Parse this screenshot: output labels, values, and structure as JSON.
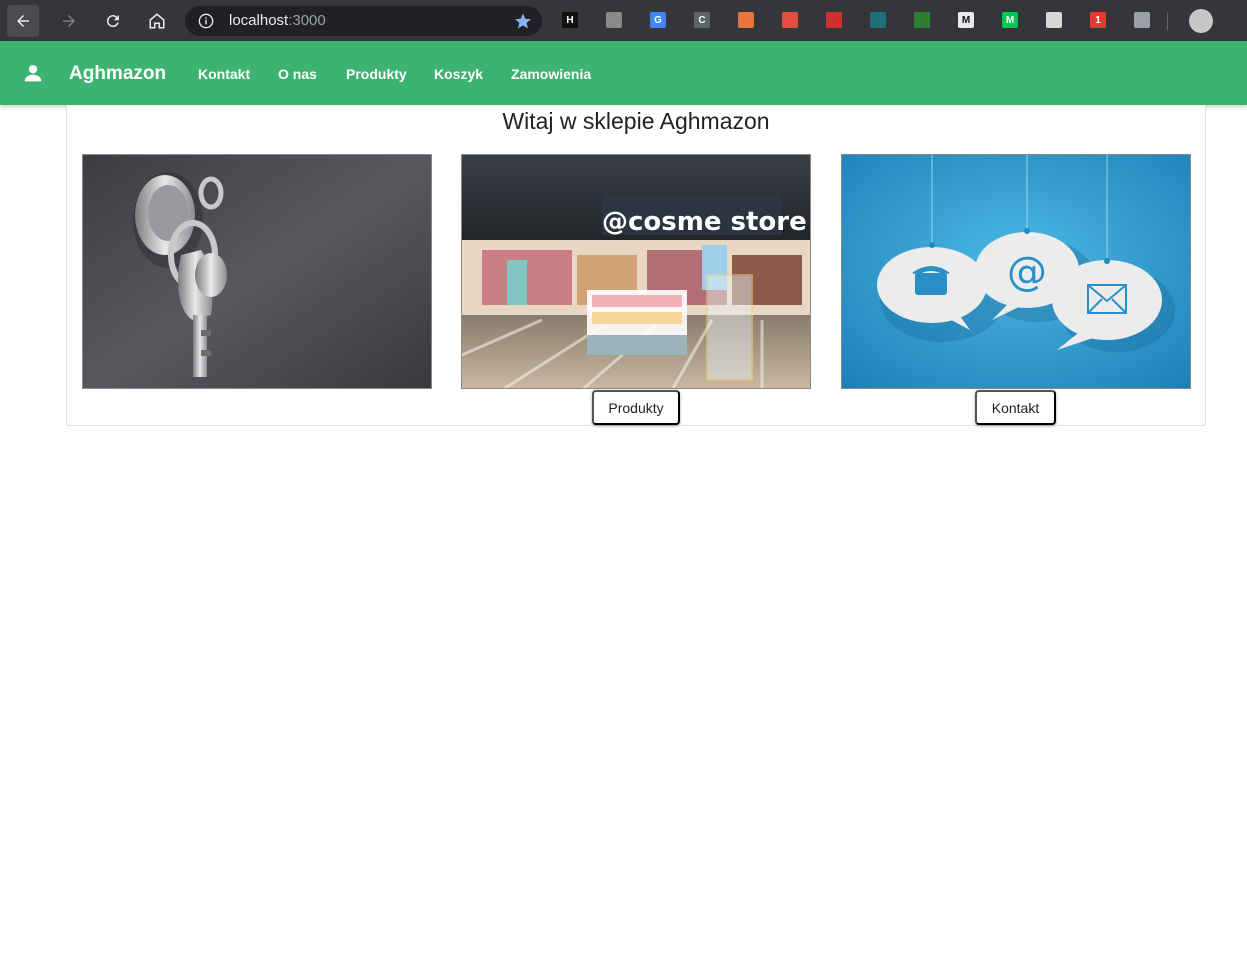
{
  "browser": {
    "url_host": "localhost",
    "url_port": ":3000",
    "extensions": [
      {
        "icon": "h-icon",
        "label": "H",
        "color": "#111111"
      },
      {
        "icon": "link-icon",
        "label": "",
        "color": "#8a8a8a"
      },
      {
        "icon": "translate-icon",
        "label": "G",
        "color": "#4285f4"
      },
      {
        "icon": "c-icon",
        "label": "C",
        "color": "#5f6368"
      },
      {
        "icon": "drop-icon",
        "label": "",
        "color": "#e8743b"
      },
      {
        "icon": "grid-icon",
        "label": "",
        "color": "#e44d3a"
      },
      {
        "icon": "pocket-icon",
        "label": "",
        "color": "#d32f2f"
      },
      {
        "icon": "globe-icon",
        "label": "",
        "color": "#1e6f7a"
      },
      {
        "icon": "qb-icon",
        "label": "",
        "color": "#2e7d32"
      },
      {
        "icon": "m-icon",
        "label": "M",
        "color": "#e8eaed"
      },
      {
        "icon": "m-green-icon",
        "label": "M",
        "color": "#00c853"
      },
      {
        "icon": "mmra-icon",
        "label": "",
        "color": "#d8d8d8"
      },
      {
        "icon": "flag-icon",
        "label": "1",
        "color": "#e53935"
      },
      {
        "icon": "puzzle-icon",
        "label": "",
        "color": "#9aa0a6"
      }
    ]
  },
  "appbar": {
    "brand": "Aghmazon",
    "nav": [
      "Kontakt",
      "O nas",
      "Produkty",
      "Koszyk",
      "Zamowienia"
    ]
  },
  "main": {
    "title": "Witaj w sklepie Aghmazon",
    "tiles": [
      {
        "image": "keys-image",
        "button": ""
      },
      {
        "image": "store-image",
        "button": "Produkty"
      },
      {
        "image": "contact-image",
        "button": "Kontakt"
      }
    ]
  },
  "colors": {
    "accent": "#3cb371",
    "browser": "#35363a"
  }
}
